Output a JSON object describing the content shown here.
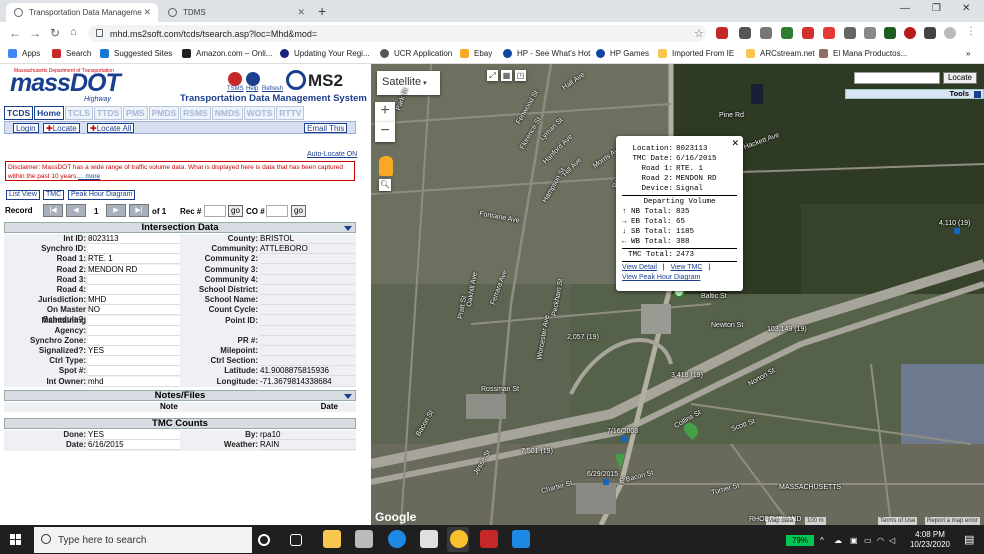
{
  "browser": {
    "tabs": [
      {
        "title": "Transportation Data Manageme",
        "active": true
      },
      {
        "title": "TDMS",
        "active": false
      }
    ],
    "url": "mhd.ms2soft.com/tcds/tsearch.asp?loc=Mhd&mod=",
    "bookmarks": [
      "Apps",
      "Search",
      "Suggested Sites",
      "Amazon.com – Onli...",
      "Updating Your Regi...",
      "UCR Application",
      "Ebay",
      "HP - See What's Hot",
      "HP Games",
      "Imported From IE",
      "ARCstream.net",
      "El Mana Productos..."
    ],
    "more_bookmarks": "»"
  },
  "header": {
    "logo": "massDOT",
    "logo_tagline": "Massachusetts Department of Transportation",
    "logo_highway": "Highway",
    "icon_labels": [
      "TSMS",
      "Help",
      "Refresh"
    ],
    "brand": "MS2",
    "app_title": "Transportation Data Management System"
  },
  "module_tabs": [
    "TCDS",
    "Home",
    "TCLS",
    "TTDS",
    "PMS",
    "PMDS",
    "RSMS",
    "NMDS",
    "WOTS",
    "RTTV"
  ],
  "buttons": {
    "login": "Login",
    "locate": "Locate",
    "locate_all": "Locate All",
    "email_this": "Email This",
    "auto_locate": "Auto-Locate ON",
    "list_view": "List View",
    "tmc": "TMC",
    "peak_hour": "Peak Hour Diagram",
    "go": "go"
  },
  "disclaimer": {
    "text": "Disclaimer: MassDOT has a wide range of traffic volume data. What is displayed here is data that has been captured within the past 10 years.",
    "more": "... more"
  },
  "record_nav": {
    "label": "Record",
    "current": "1",
    "of": "of 1",
    "rec_label": "Rec #",
    "co_label": "CO #"
  },
  "intersection": {
    "title": "Intersection Data",
    "rows": [
      {
        "l1": "Int ID:",
        "v1": "8023113",
        "l2": "County:",
        "v2": "BRISTOL"
      },
      {
        "l1": "Synchro ID:",
        "v1": "",
        "l2": "Community:",
        "v2": "ATTLEBORO"
      },
      {
        "l1": "Road 1:",
        "v1": "RTE. 1",
        "l2": "Community 2:",
        "v2": ""
      },
      {
        "l1": "Road 2:",
        "v1": "MENDON RD",
        "l2": "Community 3:",
        "v2": ""
      },
      {
        "l1": "Road 3:",
        "v1": "",
        "l2": "Community 4:",
        "v2": ""
      },
      {
        "l1": "Road 4:",
        "v1": "",
        "l2": "School District:",
        "v2": ""
      },
      {
        "l1": "Jurisdiction:",
        "v1": "MHD",
        "l2": "School Name:",
        "v2": ""
      },
      {
        "l1": "On Master Schedule?:",
        "v1": "NO",
        "l2": "Count Cycle:",
        "v2": ""
      },
      {
        "l1": "Maintaining",
        "v1": "",
        "l2": "Point ID:",
        "v2": ""
      },
      {
        "l1": "Agency:",
        "v1": "",
        "l2": "",
        "v2": ""
      },
      {
        "l1": "Synchro Zone:",
        "v1": "",
        "l2": "PR #:",
        "v2": ""
      },
      {
        "l1": "Signalized?:",
        "v1": "YES",
        "l2": "Milepoint:",
        "v2": ""
      },
      {
        "l1": "Ctrl Type:",
        "v1": "",
        "l2": "Ctrl Section:",
        "v2": ""
      },
      {
        "l1": "Spot #:",
        "v1": "",
        "l2": "Latitude:",
        "v2": "41.9008875815936"
      },
      {
        "l1": "Int Owner:",
        "v1": "mhd",
        "l2": "Longitude:",
        "v2": "-71.3679814338684"
      }
    ]
  },
  "notes": {
    "title": "Notes/Files",
    "col_note": "Note",
    "col_date": "Date"
  },
  "tmc_counts": {
    "title": "TMC Counts",
    "rows": [
      {
        "l1": "Done:",
        "v1": "YES",
        "l2": "By:",
        "v2": "rpa10"
      },
      {
        "l1": "Date:",
        "v1": "6/16/2015",
        "l2": "Weather:",
        "v2": "RAIN"
      }
    ]
  },
  "map": {
    "type_button": "Satellite",
    "locate_button": "Locate",
    "tools_label": "Tools",
    "google": "Google",
    "footer": [
      "Map data",
      "100 m",
      "Terms of Use",
      "Report a map error"
    ],
    "labels": [
      "Hall Ave",
      "Park St",
      "Fenwood St",
      "Florence St",
      "Lyman St",
      "Hanford Ave",
      "Hill Ave",
      "Morris Ave",
      "Robinson Ave",
      "Pine Rd",
      "Hackett Ave",
      "Fontaine Ave",
      "Ferrara Ave",
      "Oakhill Ave",
      "Peckham St",
      "Hampson St",
      "Baltic St",
      "Newton St",
      "Bacon St",
      "Rossman St",
      "Collins St",
      "Norton St",
      "Scott St",
      "Jesse St",
      "Charter St",
      "Turner St",
      "E Bacon St",
      "MASSACHUSETTS",
      "RHODE ISLAND",
      "Worcester Ave",
      "Pratt St"
    ],
    "counts": [
      "4,110 (19)",
      "2,057 (19)",
      "103,149 (19)",
      "3,418 (19)",
      "7/16/2008",
      "7,501 (19)",
      "6/29/2015"
    ],
    "popup": {
      "location_k": "Location:",
      "location_v": "8023113",
      "date_k": "TMC Date:",
      "date_v": "6/16/2015",
      "road1_k": "Road 1:",
      "road1_v": "RTE. 1",
      "road2_k": "Road 2:",
      "road2_v": "MENDON RD",
      "device_k": "Device:",
      "device_v": "Signal",
      "departing": "Departing Volume",
      "nb_k": "↑ NB Total:",
      "nb_v": "835",
      "eb_k": "→ EB Total:",
      "eb_v": "65",
      "sb_k": "↓ SB Total:",
      "sb_v": "1185",
      "wb_k": "← WB Total:",
      "wb_v": "388",
      "tmc_k": "TMC Total:",
      "tmc_v": "2473",
      "view_detail": "View Detail",
      "view_tmc": "View TMC",
      "view_peak": "View Peak Hour Diagram",
      "sep": "|"
    }
  },
  "taskbar": {
    "search_placeholder": "Type here to search",
    "battery": "79%",
    "time": "4:08 PM",
    "date": "10/23/2020"
  }
}
